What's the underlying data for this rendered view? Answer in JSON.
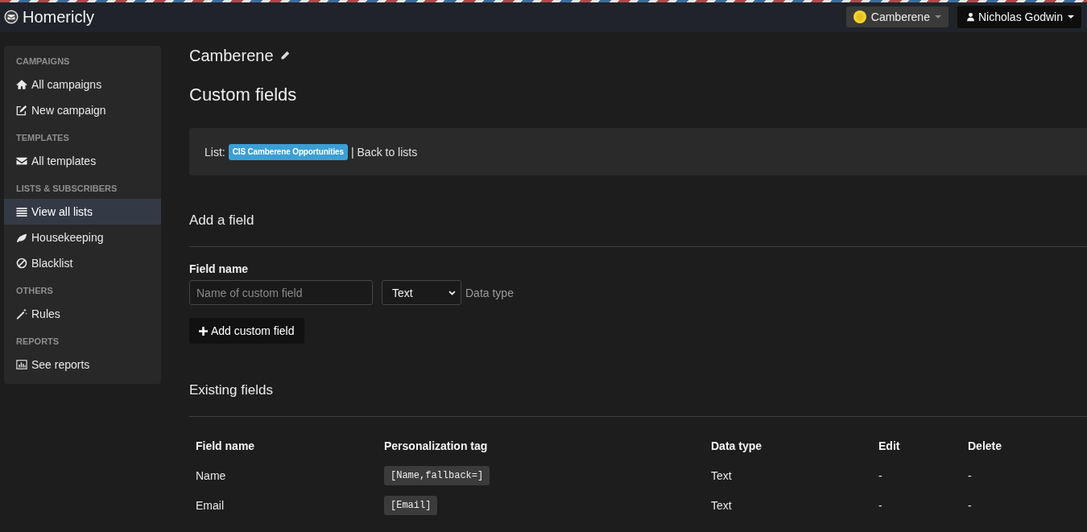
{
  "navbar": {
    "brand": "Homericly",
    "org_menu": {
      "label": "Camberene"
    },
    "user_menu": {
      "label": "Nicholas Godwin"
    }
  },
  "sidebar": {
    "sections": [
      {
        "heading": "CAMPAIGNS",
        "items": [
          {
            "label": "All campaigns",
            "selected": false
          },
          {
            "label": "New campaign",
            "selected": false
          }
        ]
      },
      {
        "heading": "TEMPLATES",
        "items": [
          {
            "label": "All templates",
            "selected": false
          }
        ]
      },
      {
        "heading": "LISTS & SUBSCRIBERS",
        "items": [
          {
            "label": "View all lists",
            "selected": true
          },
          {
            "label": "Housekeeping",
            "selected": false
          },
          {
            "label": "Blacklist",
            "selected": false
          }
        ]
      },
      {
        "heading": "OTHERS",
        "items": [
          {
            "label": "Rules",
            "selected": false
          }
        ]
      },
      {
        "heading": "REPORTS",
        "items": [
          {
            "label": "See reports",
            "selected": false
          }
        ]
      }
    ]
  },
  "page": {
    "title": "Camberene",
    "heading": "Custom fields",
    "list_bar": {
      "label": "List:",
      "list_name": "CIS Camberene Opportunities",
      "separator": "|",
      "back_link": "Back to lists"
    },
    "add_field": {
      "heading": "Add a field",
      "field_label": "Field name",
      "name_input": {
        "placeholder": "Name of custom field"
      },
      "type_select": {
        "value": "Text"
      },
      "type_hint": "Data type",
      "submit_button": "Add custom field"
    },
    "existing_fields": {
      "heading": "Existing fields",
      "table": {
        "columns": [
          {
            "label": "Field name",
            "kind": "text"
          },
          {
            "label": "Personalization tag",
            "kind": "code"
          },
          {
            "label": "Data type",
            "kind": "text"
          },
          {
            "label": "Edit",
            "kind": "text"
          },
          {
            "label": "Delete",
            "kind": "text"
          }
        ],
        "rows": [
          {
            "cells": [
              "Name",
              "[Name,fallback=]",
              "Text",
              "-",
              "-"
            ]
          },
          {
            "cells": [
              "Email",
              "[Email]",
              "Text",
              "-",
              "-"
            ]
          }
        ]
      }
    }
  }
}
